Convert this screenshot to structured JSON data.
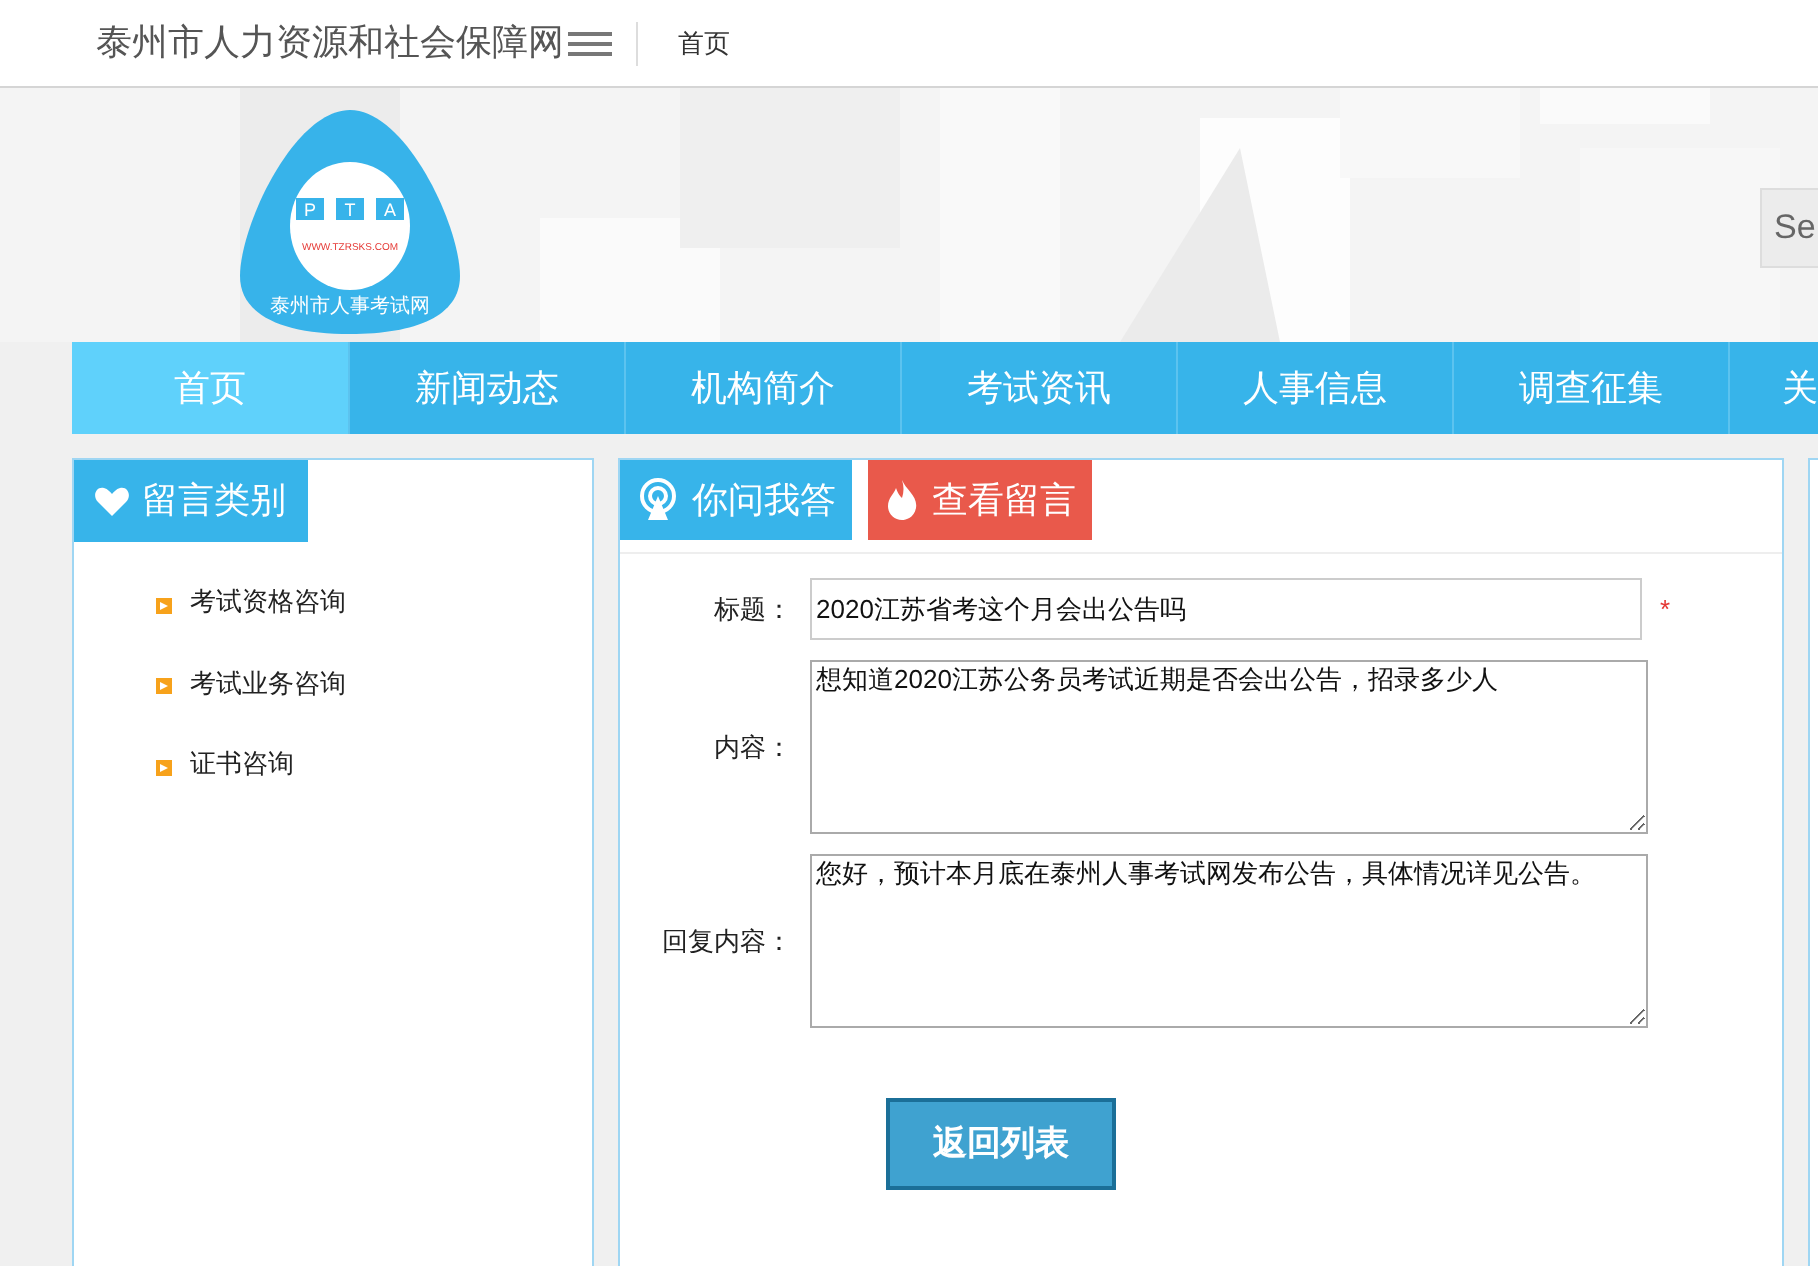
{
  "header": {
    "site_title": "泰州市人力资源和社会保障网",
    "links": [
      {
        "label": "首页"
      }
    ]
  },
  "banner": {
    "logo": {
      "letters": [
        "P",
        "T",
        "A"
      ],
      "url": "WWW.TZRSKS.COM",
      "name": "泰州市人事考试网"
    },
    "search": {
      "placeholder": "Se"
    }
  },
  "nav": [
    {
      "label": "首页",
      "selected": true
    },
    {
      "label": "新闻动态",
      "selected": false
    },
    {
      "label": "机构简介",
      "selected": false
    },
    {
      "label": "考试资讯",
      "selected": false
    },
    {
      "label": "人事信息",
      "selected": false
    },
    {
      "label": "调查征集",
      "selected": false
    },
    {
      "label": "关",
      "selected": false
    }
  ],
  "sidebar": {
    "title": "留言类别",
    "items": [
      {
        "label": "考试资格咨询"
      },
      {
        "label": "考试业务咨询"
      },
      {
        "label": "证书咨询"
      }
    ]
  },
  "main": {
    "tabs": [
      {
        "label": "你问我答",
        "kind": "ask"
      },
      {
        "label": "查看留言",
        "kind": "view"
      }
    ],
    "form": [
      {
        "kind": "input",
        "label": "标题：",
        "value": "2020江苏省考这个月会出公告吗",
        "mark": "*"
      },
      {
        "kind": "textarea",
        "label": "内容：",
        "value": "想知道2020江苏公务员考试近期是否会出公告，招录多少人"
      },
      {
        "kind": "textarea",
        "label": "回复内容：",
        "value": "您好，预计本月底在泰州人事考试网发布公告，具体情况详见公告。"
      }
    ],
    "button": "返回列表"
  }
}
